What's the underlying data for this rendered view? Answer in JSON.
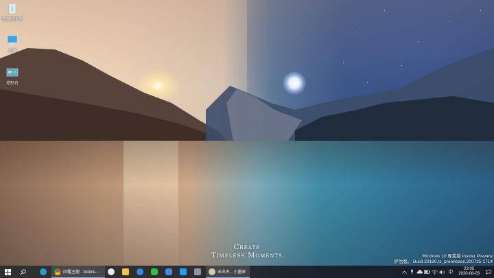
{
  "desktop": {
    "icons": [
      {
        "label": "資源回收筒",
        "icon": "recycle-bin-icon"
      },
      {
        "label": "本機",
        "icon": "this-pc-icon"
      },
      {
        "label": "控制台",
        "icon": "control-panel-icon"
      }
    ]
  },
  "wallpaper": {
    "brand_line1": "Create",
    "brand_line2": "Timeless Moments"
  },
  "watermark": {
    "line1": "Windows 10 專業版 Insider Preview",
    "line2": "評估版。 Build 20180.rs_prerelease.200725-1714"
  },
  "taskbar": {
    "start": "start-icon",
    "search": "search-icon",
    "apps": [
      {
        "name": "edge",
        "label": "",
        "color": "#1f9bd8"
      },
      {
        "name": "chrome",
        "label": "回覆主題 - Mobile...",
        "color": "#e34133",
        "active": true
      },
      {
        "name": "itunes",
        "label": "",
        "color": "#e8e8f8"
      },
      {
        "name": "file-explorer",
        "label": "",
        "color": "#f2c14e"
      },
      {
        "name": "messenger",
        "label": "",
        "color": "#2b8cf6"
      },
      {
        "name": "line",
        "label": "",
        "color": "#2bc248"
      },
      {
        "name": "instagram",
        "label": "",
        "color": "#3d8de0"
      },
      {
        "name": "twitter",
        "label": "",
        "color": "#1da1f2"
      },
      {
        "name": "app-gray",
        "label": "",
        "color": "#8a96a8"
      },
      {
        "name": "paint",
        "label": "未命名 - 小畫家",
        "color": "#d9c9a6",
        "active": true
      }
    ],
    "tray": {
      "ime": "中",
      "time": "23:05",
      "date": "2020-08-03"
    }
  }
}
